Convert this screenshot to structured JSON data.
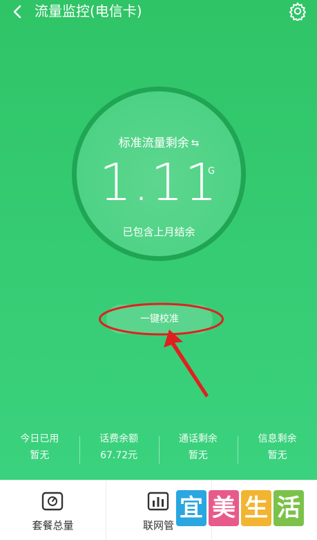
{
  "header": {
    "title": "流量监控(电信卡)",
    "back_icon": "chevron-left-icon",
    "settings_icon": "gear-icon"
  },
  "usage_ring": {
    "label": "标准流量剩余",
    "refresh_icon": "refresh-icon",
    "remaining_value": "1.11",
    "unit": "G",
    "subtitle": "已包含上月结余"
  },
  "calibrate_button": {
    "label": "一键校准"
  },
  "stats": [
    {
      "label": "今日已用",
      "value": "暂无"
    },
    {
      "label": "话费余额",
      "value": "67.72元"
    },
    {
      "label": "通话剩余",
      "value": "暂无"
    },
    {
      "label": "信息剩余",
      "value": "暂无"
    }
  ],
  "bottom_tabs": [
    {
      "label": "套餐总量",
      "icon": "gauge-icon"
    },
    {
      "label": "联网管",
      "icon": "bar-chart-icon"
    }
  ],
  "watermark": {
    "chars": [
      "宜",
      "美",
      "生",
      "活"
    ],
    "colors": [
      "#2aa6e0",
      "#e85a8a",
      "#f2b531",
      "#7cc24a"
    ]
  },
  "colors": {
    "primary_green": "#36cc74",
    "ring_border": "#20a554",
    "annotation_red": "#e02020"
  }
}
